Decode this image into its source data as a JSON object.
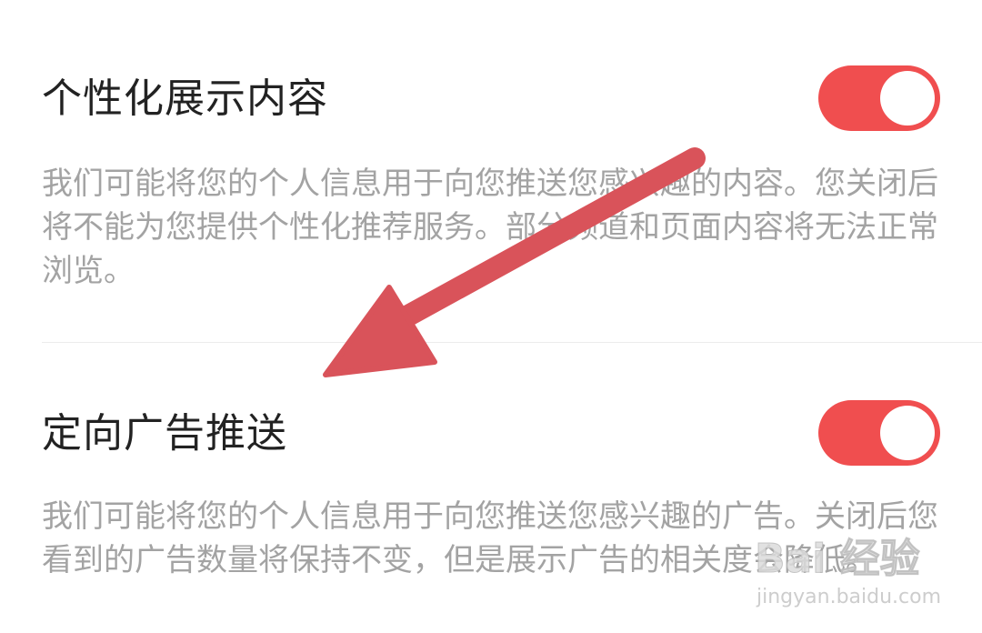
{
  "settings": [
    {
      "title": "个性化展示内容",
      "description": "我们可能将您的个人信息用于向您推送您感兴趣的内容。您关闭后将不能为您提供个性化推荐服务。部分频道和页面内容将无法正常浏览。",
      "enabled": true
    },
    {
      "title": "定向广告推送",
      "description": "我们可能将您的个人信息用于向您推送您感兴趣的广告。关闭后您看到的广告数量将保持不变，但是展示广告的相关度会降低。",
      "enabled": true
    }
  ],
  "colors": {
    "toggle_on": "#f04e4f",
    "arrow": "#d9535a",
    "title_text": "#222222",
    "desc_text": "#a3a3a3"
  },
  "watermark": {
    "logo_text": "Bai 经验",
    "url": "jingyan.baidu.com"
  }
}
